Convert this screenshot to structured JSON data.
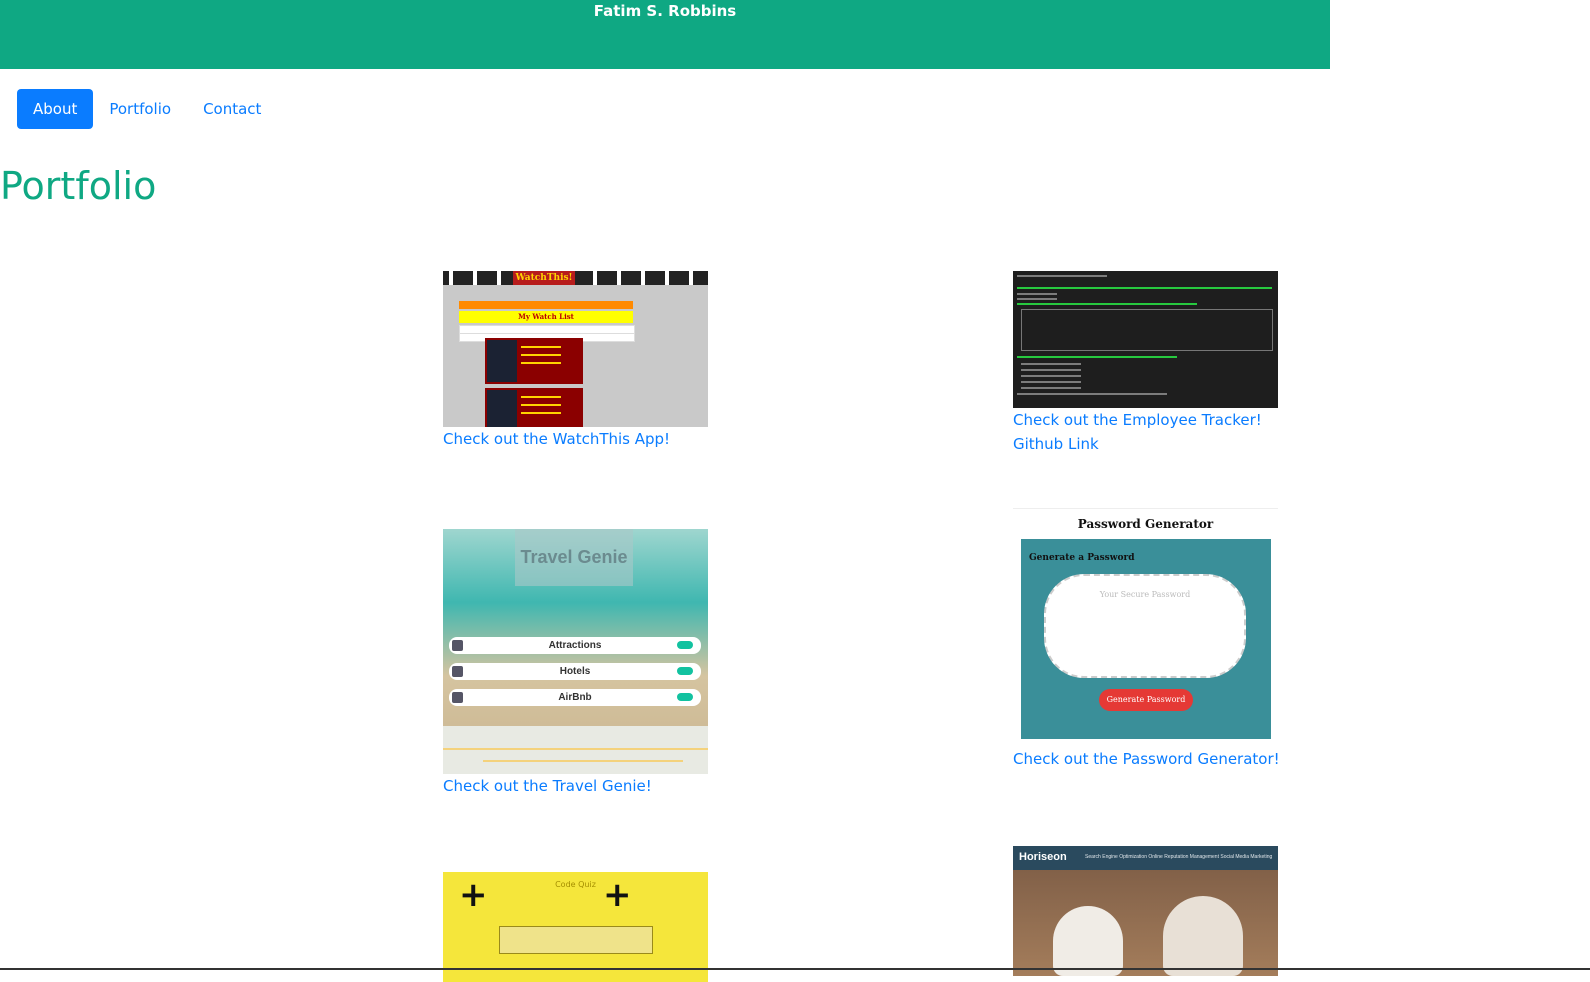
{
  "header": {
    "name": "Fatim S. Robbins"
  },
  "nav": {
    "items": [
      "About",
      "Portfolio",
      "Contact"
    ]
  },
  "page": {
    "title": "Portfolio"
  },
  "projects": [
    {
      "link": "Check out the WatchThis App!"
    },
    {
      "link": "Check out the Employee Tracker!",
      "extra_link": "Github Link"
    },
    {
      "link": "Check out the Travel Genie!"
    },
    {
      "link": "Check out the Password Generator!"
    }
  ],
  "thumbs": {
    "watchthis": {
      "logo": "WatchThis!",
      "list_title": "My Watch List"
    },
    "travel": {
      "logo": "Travel Genie",
      "rows": [
        "Attractions",
        "Hotels",
        "AirBnb"
      ]
    },
    "password": {
      "title": "Password Generator",
      "subtitle": "Generate a Password",
      "placeholder": "Your Secure Password",
      "button": "Generate Password"
    },
    "quiz": {
      "title": "Code Quiz"
    },
    "horiseon": {
      "brand": "Horiseon",
      "nav": "Search Engine Optimization    Online Reputation Management    Social Media Marketing"
    }
  },
  "colors": {
    "brand": "#0fa883",
    "link": "#0a7cff"
  }
}
